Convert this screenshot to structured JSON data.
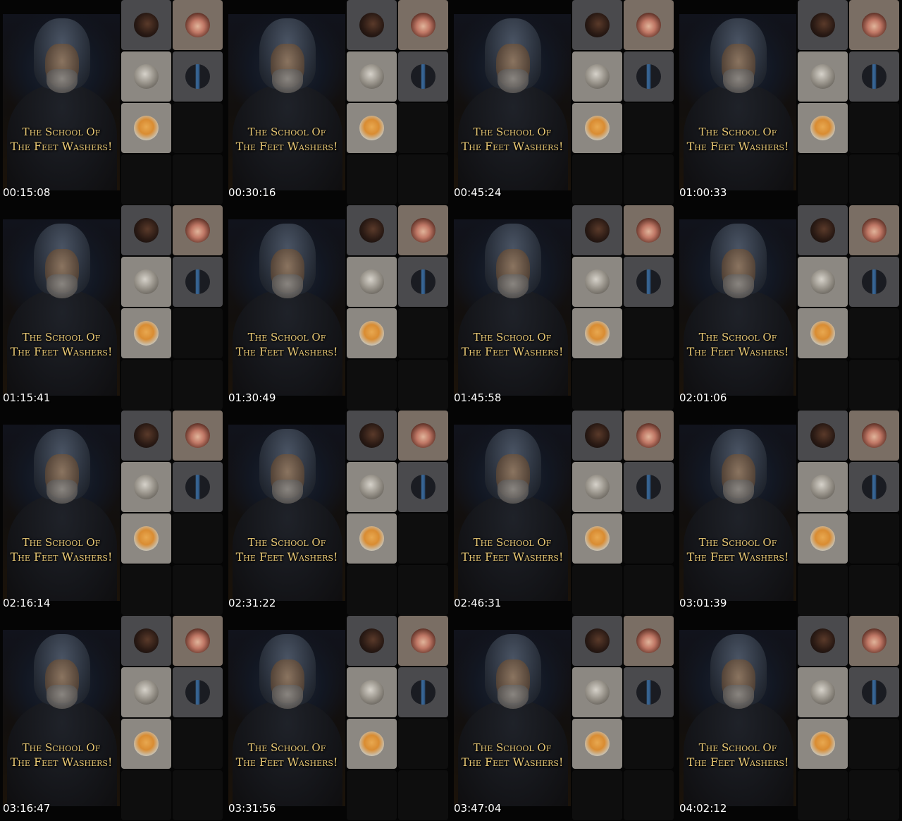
{
  "overlay": {
    "line1": "The School Of",
    "line2": "The Feet Washers!"
  },
  "participants": [
    {
      "icon": "participant-avatar-woman-dark-hair-icon",
      "slot": "p1"
    },
    {
      "icon": "participant-avatar-woman-glasses-icon",
      "slot": "p2"
    },
    {
      "icon": "participant-avatar-grey-portrait-icon",
      "slot": "p3"
    },
    {
      "icon": "participant-avatar-man-blue-shirt-icon",
      "slot": "p4"
    },
    {
      "icon": "participant-avatar-cartoon-dog-icon",
      "slot": "p5"
    }
  ],
  "frames": [
    {
      "timestamp": "00:15:08"
    },
    {
      "timestamp": "00:30:16"
    },
    {
      "timestamp": "00:45:24"
    },
    {
      "timestamp": "01:00:33"
    },
    {
      "timestamp": "01:15:41"
    },
    {
      "timestamp": "01:30:49"
    },
    {
      "timestamp": "01:45:58"
    },
    {
      "timestamp": "02:01:06"
    },
    {
      "timestamp": "02:16:14"
    },
    {
      "timestamp": "02:31:22"
    },
    {
      "timestamp": "02:46:31"
    },
    {
      "timestamp": "03:01:39"
    },
    {
      "timestamp": "03:16:47"
    },
    {
      "timestamp": "03:31:56"
    },
    {
      "timestamp": "03:47:04"
    },
    {
      "timestamp": "04:02:12"
    }
  ]
}
